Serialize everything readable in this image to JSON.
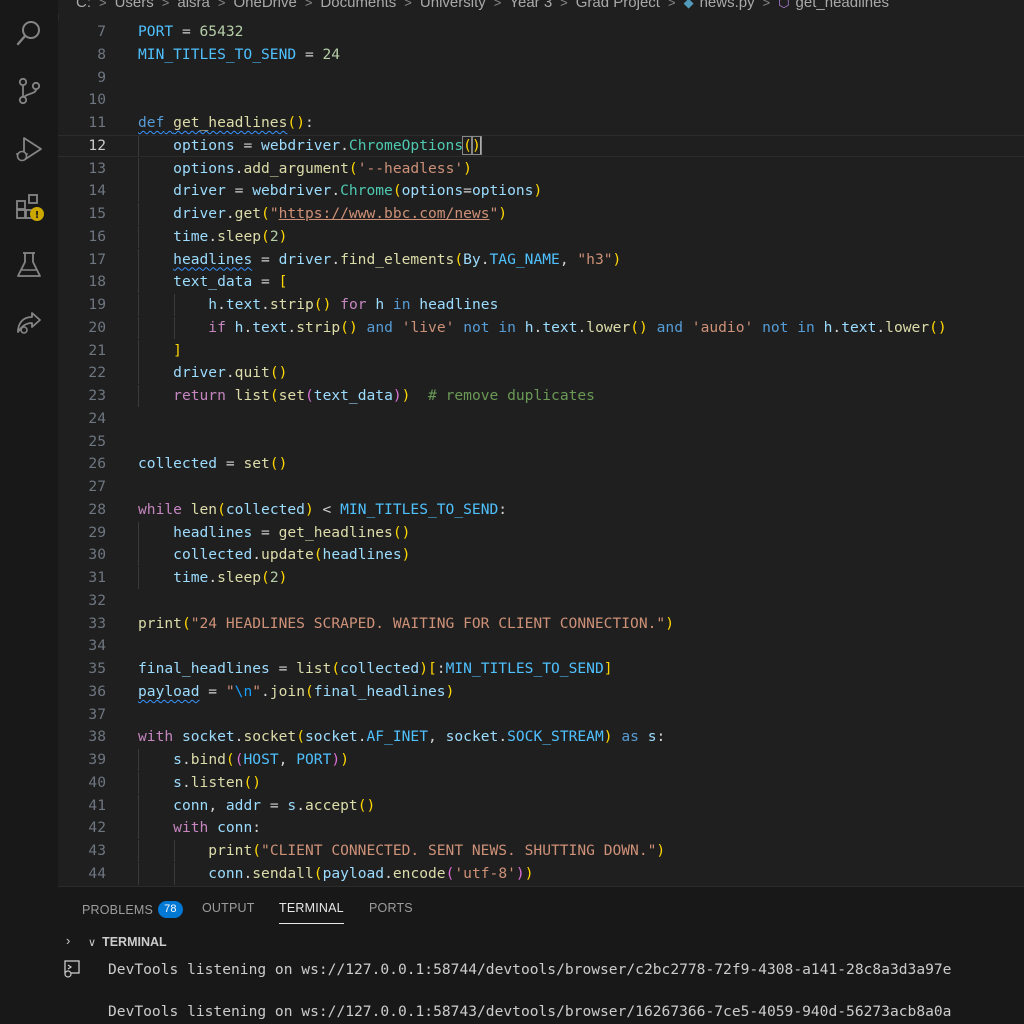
{
  "breadcrumb": {
    "items": [
      "C:",
      "Users",
      "aisra",
      "OneDrive",
      "Documents",
      "University",
      "Year 3",
      "Grad Project"
    ],
    "file": "news.py",
    "symbol": "get_headlines"
  },
  "activity_bar": {
    "icons": [
      "search-icon",
      "source-control-icon",
      "run-debug-icon",
      "extensions-icon",
      "testing-icon",
      "remote-icon"
    ],
    "warning_color": "#cca700"
  },
  "editor": {
    "current_line": "12",
    "lines": [
      {
        "n": "7",
        "text": "PORT = 65432"
      },
      {
        "n": "8",
        "text": "MIN_TITLES_TO_SEND = 24"
      },
      {
        "n": "9",
        "text": ""
      },
      {
        "n": "10",
        "text": ""
      },
      {
        "n": "11",
        "text": "def get_headlines():"
      },
      {
        "n": "12",
        "text": "    options = webdriver.ChromeOptions()"
      },
      {
        "n": "13",
        "text": "    options.add_argument('--headless')"
      },
      {
        "n": "14",
        "text": "    driver = webdriver.Chrome(options=options)"
      },
      {
        "n": "15",
        "text": "    driver.get(\"https://www.bbc.com/news\")"
      },
      {
        "n": "16",
        "text": "    time.sleep(2)"
      },
      {
        "n": "17",
        "text": "    headlines = driver.find_elements(By.TAG_NAME, \"h3\")"
      },
      {
        "n": "18",
        "text": "    text_data = ["
      },
      {
        "n": "19",
        "text": "        h.text.strip() for h in headlines"
      },
      {
        "n": "20",
        "text": "        if h.text.strip() and 'live' not in h.text.lower() and 'audio' not in h.text.lower()"
      },
      {
        "n": "21",
        "text": "    ]"
      },
      {
        "n": "22",
        "text": "    driver.quit()"
      },
      {
        "n": "23",
        "text": "    return list(set(text_data))  # remove duplicates"
      },
      {
        "n": "24",
        "text": ""
      },
      {
        "n": "25",
        "text": ""
      },
      {
        "n": "26",
        "text": "collected = set()"
      },
      {
        "n": "27",
        "text": ""
      },
      {
        "n": "28",
        "text": "while len(collected) < MIN_TITLES_TO_SEND:"
      },
      {
        "n": "29",
        "text": "    headlines = get_headlines()"
      },
      {
        "n": "30",
        "text": "    collected.update(headlines)"
      },
      {
        "n": "31",
        "text": "    time.sleep(2)"
      },
      {
        "n": "32",
        "text": ""
      },
      {
        "n": "33",
        "text": "print(\"24 HEADLINES SCRAPED. WAITING FOR CLIENT CONNECTION.\")"
      },
      {
        "n": "34",
        "text": ""
      },
      {
        "n": "35",
        "text": "final_headlines = list(collected)[:MIN_TITLES_TO_SEND]"
      },
      {
        "n": "36",
        "text": "payload = \"\\n\".join(final_headlines)"
      },
      {
        "n": "37",
        "text": ""
      },
      {
        "n": "38",
        "text": "with socket.socket(socket.AF_INET, socket.SOCK_STREAM) as s:"
      },
      {
        "n": "39",
        "text": "    s.bind((HOST, PORT))"
      },
      {
        "n": "40",
        "text": "    s.listen()"
      },
      {
        "n": "41",
        "text": "    conn, addr = s.accept()"
      },
      {
        "n": "42",
        "text": "    with conn:"
      },
      {
        "n": "43",
        "text": "        print(\"CLIENT CONNECTED. SENT NEWS. SHUTTING DOWN.\")"
      },
      {
        "n": "44",
        "text": "        conn.sendall(payload.encode('utf-8'))"
      }
    ]
  },
  "panel": {
    "tabs": [
      {
        "label": "PROBLEMS",
        "badge": "78"
      },
      {
        "label": "OUTPUT"
      },
      {
        "label": "TERMINAL"
      },
      {
        "label": "PORTS"
      }
    ],
    "active_tab": "TERMINAL",
    "section_header": "TERMINAL",
    "terminal_lines": [
      "DevTools listening on ws://127.0.0.1:58744/devtools/browser/c2bc2778-72f9-4308-a141-28c8a3d3a97e",
      "DevTools listening on ws://127.0.0.1:58743/devtools/browser/16267366-7ce5-4059-940d-56273acb8a0a"
    ]
  }
}
